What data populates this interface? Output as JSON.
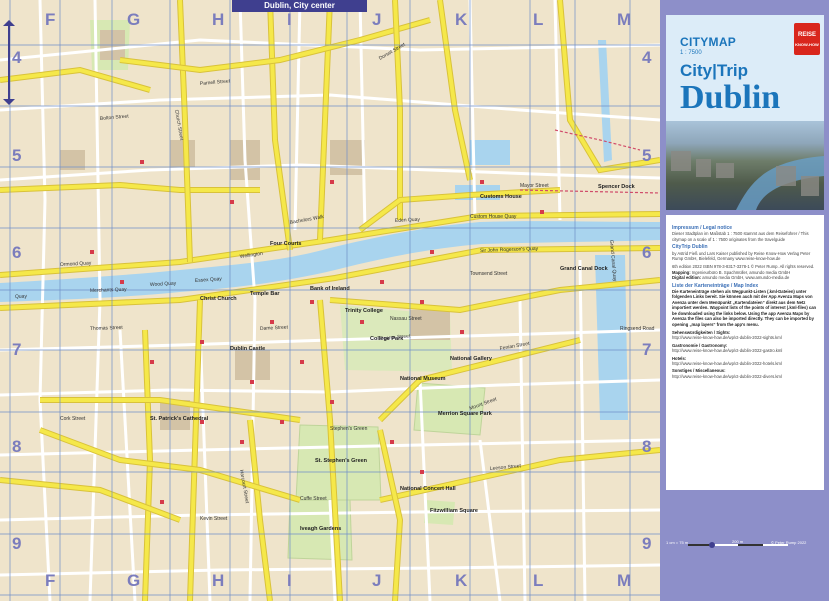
{
  "map": {
    "strip_title": "Dublin, City center",
    "grid_letters_top": [
      "F",
      "G",
      "H",
      "I",
      "J",
      "K",
      "L",
      "M"
    ],
    "grid_letters_bottom": [
      "F",
      "G",
      "H",
      "I",
      "J",
      "K",
      "L",
      "M"
    ],
    "grid_numbers": [
      "4",
      "5",
      "6",
      "7",
      "8",
      "9"
    ],
    "streets": [
      "Quay",
      "Merchants Quay",
      "Wood Quay",
      "Essex Quay",
      "Ormond Quay",
      "Wellington",
      "Bachelors Walk",
      "Eden Quay",
      "Custom House Quay",
      "Sir John Rogerson's Quay",
      "Leeson Street",
      "Mount Street",
      "Harcourt Street",
      "Stephen's Green",
      "Dame Street",
      "Thomas Street",
      "Mayor Street",
      "Cork Street",
      "Fenian Street",
      "Pearse Street",
      "Parnell Street",
      "Dorset Street",
      "Bolton Street",
      "Church Street",
      "Cuffe Street",
      "Kevin Street",
      "Nassau Street",
      "Townsend Street",
      "Grand Canal Quay",
      "Ringsend Road"
    ],
    "places": [
      "Trinity College",
      "Dublin Castle",
      "St. Stephen's Green",
      "Merrion Square Park",
      "Iveagh Gardens",
      "College Park",
      "Spencer Dock",
      "Four Courts",
      "National Concert Hall",
      "Bank of Ireland",
      "Christ Church",
      "St. Patrick's Cathedral",
      "Customs House",
      "Grand Canal Dock",
      "Fitzwilliam Square",
      "National Museum",
      "National Gallery",
      "Temple Bar"
    ]
  },
  "cover": {
    "series": "CITYMAP",
    "scale": "1 : 7500",
    "brand": "City|Trip",
    "city": "Dublin",
    "logo_top": "REISE",
    "logo_bottom": "KNOW-HOW"
  },
  "info": {
    "h1": "Impressum / Legal notice",
    "p1": "Dieser Stadtplan im Maßstab 1 : 7500 stammt aus dem Reiseführer / This citymap on a scale of 1 : 7500 originates from the travelguide",
    "h2": "CityTrip Dublin",
    "p2": "by Astrid Fieß und Lars Kaiser published by Reise Know-How Verlag Peter Rump GmbH, Bielefeld, Germany www.reise-know-how.de",
    "p3": "6th edition 2022 ISBN 978-3-8317-3378-1 © Peter Rump. All rights reserved.",
    "p4a": "Mapping:",
    "p4b": "Ingenieurbüro B. Spachmüller, amundo media GmbH",
    "p5a": "Digital edition:",
    "p5b": "amundo media GmbH, www.amundo-media.de",
    "h3": "Liste der Karteneinträge / Map Index",
    "p6": "Die Karteneinträge stehen als Wegpunkt-Listen (.kml-Dateien) unter folgenden Links bereit. Sie können auch mit der App Avenza Maps von Avenza unter dem Menüpunkt „Kartendateien“ direkt aus dem Netz importiert werden. Waypoint lists of the points of interest (.kml-files) can be downloaded using the links below. Using the app Avenza Maps by Avenza the files can also be imported directly. They can be imported by opening „map layers“ from the app's menu.",
    "l1": "Sehenswürdigkeiten / Sights:",
    "u1": "http://www.reise-know-how.de/wp/ct-dublin-2022-sights.kml",
    "l2": "Gastronomie / Gastronomy:",
    "u2": "http://www.reise-know-how.de/wp/ct-dublin-2022-gastro.kml",
    "l3": "Hotels:",
    "u3": "http://www.reise-know-how.de/wp/ct-dublin-2022-hotels.kml",
    "l4": "Sonstiges / Miscellaneous:",
    "u4": "http://www.reise-know-how.de/wp/ct-dublin-2022-divers.kml"
  },
  "scalebar": {
    "left": "1 cm = 75 m",
    "right": "© Peter Rump 2022",
    "mid": "200 m"
  },
  "colors": {
    "land": "#efe4cb",
    "road_major": "#f5e84a",
    "road_minor": "#ffffff",
    "water": "#a9d4ee",
    "park": "#d7e8b3",
    "building": "#c9b89c",
    "grid": "#6f8fc8",
    "sidebar": "#8d8fc9",
    "brand_blue": "#1b75bb"
  }
}
